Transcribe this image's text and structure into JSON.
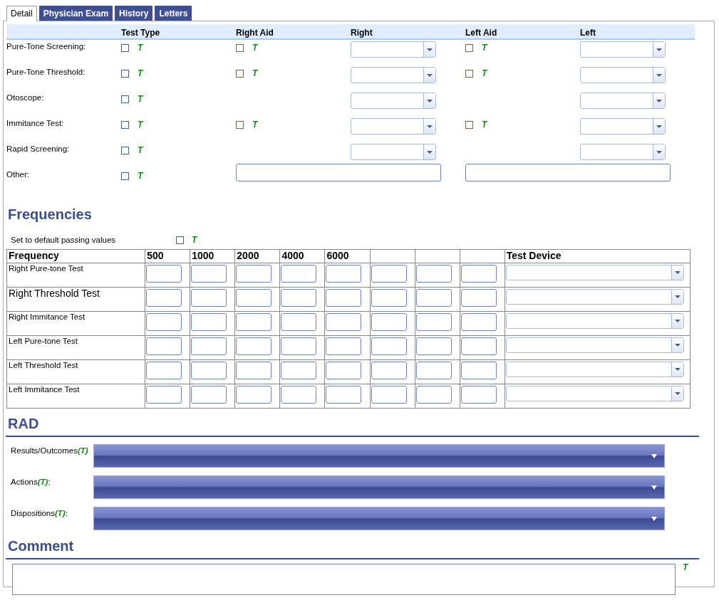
{
  "tabs": [
    {
      "label": "Detail",
      "selected": true
    },
    {
      "label": "Physician Exam",
      "selected": false
    },
    {
      "label": "History",
      "selected": false
    },
    {
      "label": "Letters",
      "selected": false
    }
  ],
  "tests": {
    "columns": [
      "Test Type",
      "Right Aid",
      "Right",
      "Left Aid",
      "Left"
    ],
    "rows": [
      {
        "label": "Pure-Tone Screening:",
        "test_type": {
          "checked": false,
          "marker": "T"
        },
        "right_aid": {
          "checked": false,
          "marker": "T"
        },
        "right": {
          "kind": "dropdown"
        },
        "left_aid": {
          "checked": false,
          "marker": "T"
        },
        "left": {
          "kind": "dropdown"
        }
      },
      {
        "label": "Pure-Tone Threshold:",
        "test_type": {
          "checked": false,
          "marker": "T"
        },
        "right_aid": {
          "checked": false,
          "marker": "T"
        },
        "right": {
          "kind": "dropdown"
        },
        "left_aid": {
          "checked": false,
          "marker": "T"
        },
        "left": {
          "kind": "dropdown"
        }
      },
      {
        "label": "Otoscope:",
        "test_type": {
          "checked": false,
          "marker": "T"
        },
        "right": {
          "kind": "dropdown"
        },
        "left": {
          "kind": "dropdown"
        }
      },
      {
        "label": "Immitance Test:",
        "test_type": {
          "checked": false,
          "marker": "T"
        },
        "right_aid": {
          "checked": false,
          "marker": "T"
        },
        "right": {
          "kind": "dropdown"
        },
        "left_aid": {
          "checked": false,
          "marker": "T"
        },
        "left": {
          "kind": "dropdown"
        }
      },
      {
        "label": "Rapid Screening:",
        "test_type": {
          "checked": false,
          "marker": "T"
        },
        "right": {
          "kind": "dropdown"
        },
        "left": {
          "kind": "dropdown"
        }
      },
      {
        "label": "Other:",
        "test_type": {
          "checked": false,
          "marker": "T"
        },
        "right": {
          "kind": "text"
        },
        "left": {
          "kind": "text"
        }
      }
    ]
  },
  "frequencies": {
    "title": "Frequencies",
    "default_values": {
      "label": "Set to default passing values",
      "checked": false,
      "marker": "T"
    },
    "first_column": "Frequency",
    "columns": [
      "500",
      "1000",
      "2000",
      "4000",
      "6000"
    ],
    "device_column": "Test Device",
    "rows": [
      {
        "label": "Right Pure-tone Test",
        "large": false
      },
      {
        "label": "Right Threshold Test",
        "large": true
      },
      {
        "label": "Right Immitance Test",
        "large": false
      },
      {
        "label": "Left Pure-tone Test",
        "large": false
      },
      {
        "label": "Left Threshold Test",
        "large": false
      },
      {
        "label": "Left Immitance Test",
        "large": false
      }
    ]
  },
  "rad": {
    "title": "RAD",
    "fields": [
      {
        "label": "Results/Outcomes",
        "marker": "(T)"
      },
      {
        "label": "Actions",
        "marker": "(T)",
        "suffix": ":"
      },
      {
        "label": "Dispositions",
        "marker": "(T)",
        "suffix": ":"
      }
    ]
  },
  "comment": {
    "title": "Comment",
    "marker": "T"
  }
}
